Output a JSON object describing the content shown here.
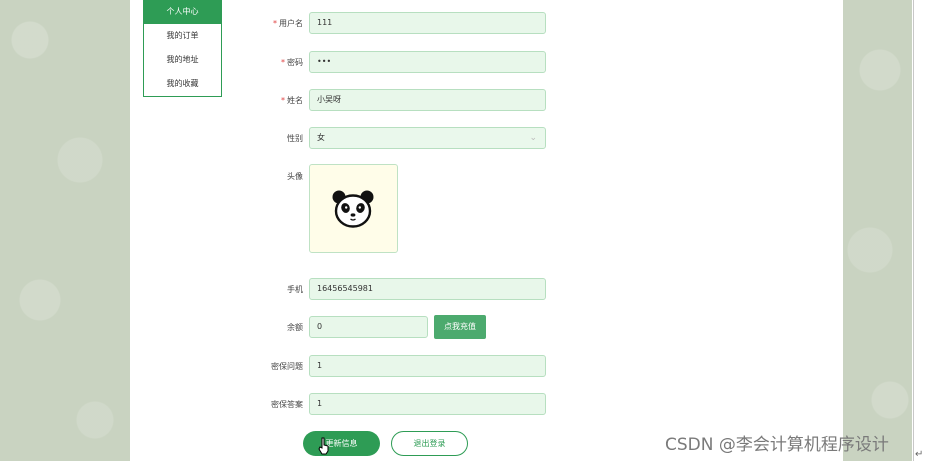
{
  "sidebar": {
    "items": [
      {
        "label": "个人中心",
        "active": true
      },
      {
        "label": "我的订单"
      },
      {
        "label": "我的地址"
      },
      {
        "label": "我的收藏"
      }
    ]
  },
  "form": {
    "username": {
      "label": "用户名",
      "value": "111",
      "required": true
    },
    "password": {
      "label": "密码",
      "value": "•••",
      "required": true
    },
    "name": {
      "label": "姓名",
      "value": "小吴呀",
      "required": true
    },
    "gender": {
      "label": "性别",
      "value": "女"
    },
    "avatar": {
      "label": "头像",
      "icon": "panda-avatar"
    },
    "phone": {
      "label": "手机",
      "value": "16456545981"
    },
    "balance": {
      "label": "余额",
      "value": "0",
      "recharge_label": "点我充值"
    },
    "security_question": {
      "label": "密保问题",
      "value": "1"
    },
    "security_answer": {
      "label": "密保答案",
      "value": "1"
    },
    "required_mark": "*"
  },
  "actions": {
    "update_label": "更新信息",
    "logout_label": "退出登录"
  },
  "watermark": "CSDN @李会计算机程序设计",
  "colors": {
    "accent": "#2e9c55",
    "field_bg": "#e8f7ea",
    "background": "#c9d3c1"
  }
}
